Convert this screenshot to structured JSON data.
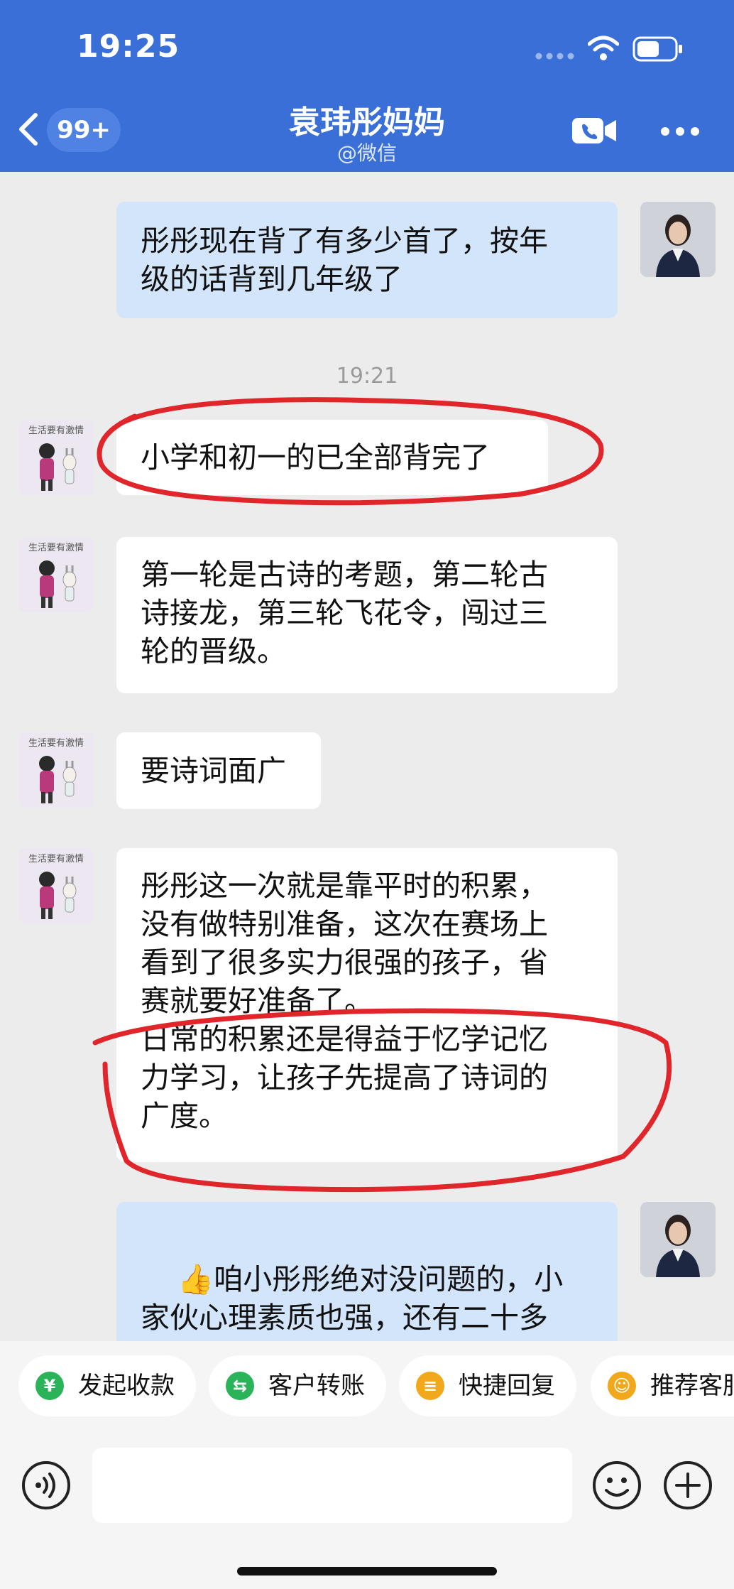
{
  "status_bar": {
    "time": "19:25"
  },
  "header": {
    "unread_count": "99+",
    "title": "袁玮彤妈妈",
    "subtitle": "@微信",
    "color": "#3a6fd8"
  },
  "timestamp": "19:21",
  "messages": [
    {
      "side": "sent",
      "text": "彤彤现在背了有多少首了，按年\n级的话背到几年级了"
    },
    {
      "side": "received",
      "text": "小学和初一的已全部背完了"
    },
    {
      "side": "received",
      "text": "第一轮是古诗的考题，第二轮古\n诗接龙，第三轮飞花令，闯过三\n轮的晋级。"
    },
    {
      "side": "received",
      "text": "要诗词面广"
    },
    {
      "side": "received",
      "text": "彤彤这一次就是靠平时的积累，\n没有做特别准备，这次在赛场上\n看到了很多实力很强的孩子，省\n赛就要好准备了。\n日常的积累还是得益于忆学记忆\n力学习，让孩子先提高了诗词的\n广度。"
    },
    {
      "side": "sent",
      "emoji": "👍",
      "text": "咱小彤彤绝对没问题的，小\n家伙心理素质也强，还有二十多\n天，再加强复习，冲进省赛了，"
    }
  ],
  "avatar_caption": "生活要有激情",
  "quick_actions": [
    {
      "label": "发起收款",
      "icon": "¥",
      "color": "#2bb35a"
    },
    {
      "label": "客户转账",
      "icon": "⇆",
      "color": "#2bb35a"
    },
    {
      "label": "快捷回复",
      "icon": "≡",
      "color": "#f2a81d"
    },
    {
      "label": "推荐客服",
      "icon": "☺",
      "color": "#f2a81d"
    }
  ],
  "annotation_color": "#e0262b"
}
